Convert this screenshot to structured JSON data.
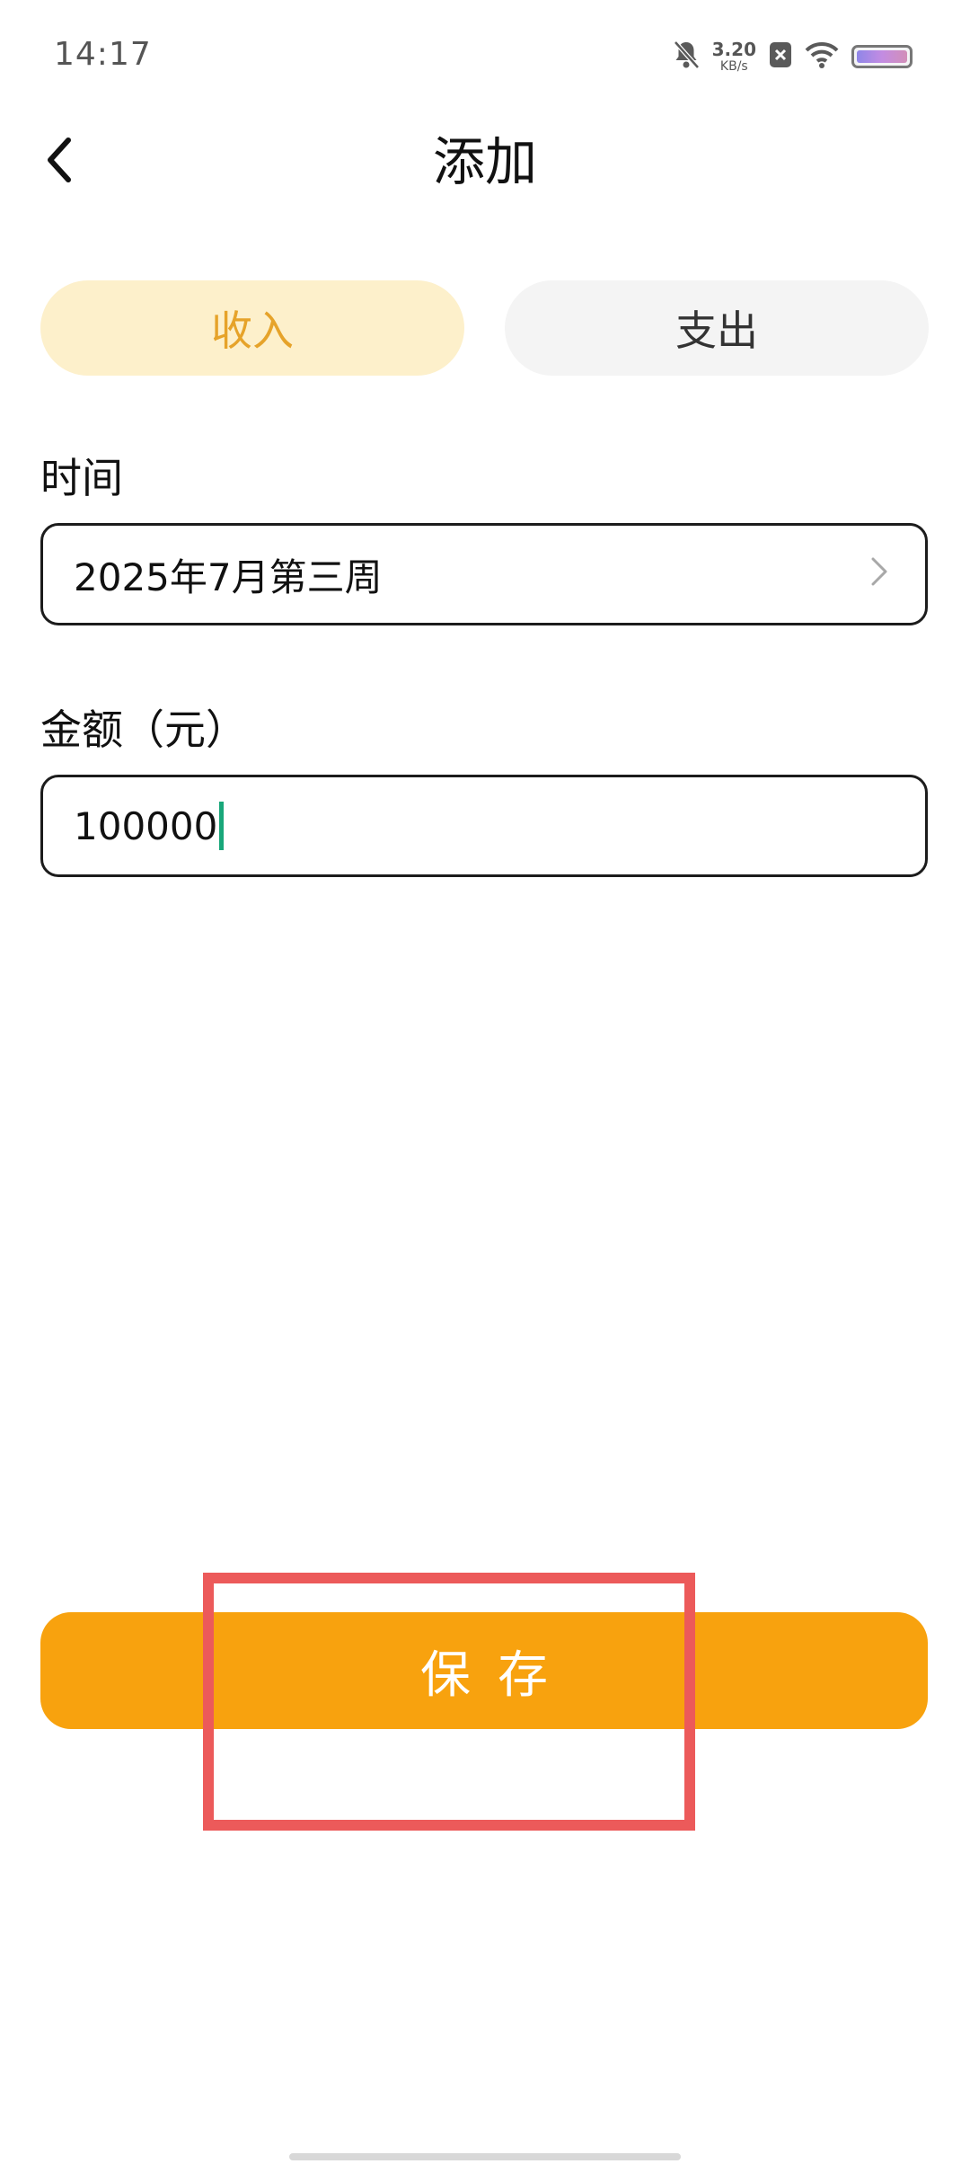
{
  "status_bar": {
    "time": "14:17",
    "net_speed_value": "3.20",
    "net_speed_unit": "KB/s",
    "icons": [
      "bell-muted-icon",
      "close-badge-icon",
      "wifi-icon",
      "battery-icon"
    ]
  },
  "header": {
    "back_icon": "chevron-left-icon",
    "title": "添加"
  },
  "tabs": [
    {
      "label": "收入",
      "selected": true
    },
    {
      "label": "支出",
      "selected": false
    }
  ],
  "form": {
    "time": {
      "label": "时间",
      "value": "2025年7月第三周",
      "icon": "chevron-right-icon"
    },
    "amount": {
      "label": "金额（元）",
      "value": "100000"
    }
  },
  "save_button": {
    "label": "保存"
  },
  "colors": {
    "accent": "#f8a20e",
    "selected_tab_bg": "#fdf0cb",
    "selected_tab_text": "#e6a32a",
    "unselected_tab_bg": "#f4f4f4",
    "caret": "#19a77a",
    "highlight": "#ec5a5a"
  }
}
